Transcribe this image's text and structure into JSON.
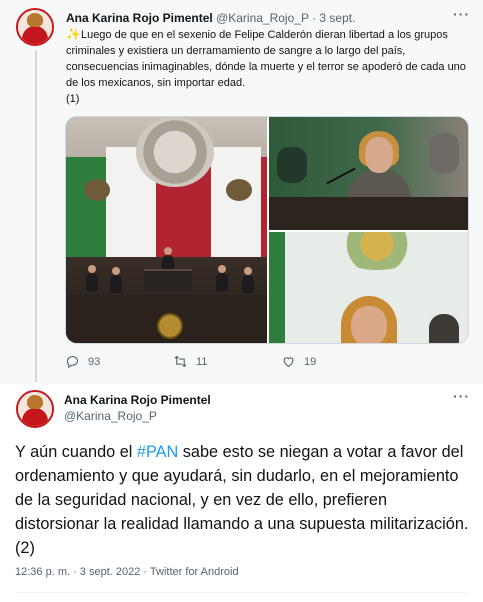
{
  "tweet1": {
    "author_name": "Ana Karina Rojo Pimentel",
    "handle": "@Karina_Rojo_P",
    "separator": "·",
    "date": "3 sept.",
    "sparkle": "✨",
    "text": "Luego de que en el sexenio de Felipe Calderón dieran libertad a los grupos criminales y existiera un derramamiento de sangre a lo largo del país, consecuencias inimaginables, dónde la muerte y el terror se apoderó de cada uno de los mexicanos, sin importar edad.",
    "counter": "(1)",
    "more_label": "···",
    "stats": {
      "replies": "93",
      "retweets": "11",
      "likes": "19"
    }
  },
  "tweet2": {
    "author_name": "Ana Karina Rojo Pimentel",
    "handle": "@Karina_Rojo_P",
    "more_label": "···",
    "text_before": "Y aún cuando el ",
    "hashtag": "#PAN",
    "text_after": " sabe esto se niegan a votar a favor del ordenamiento y que ayudará, sin dudarlo, en el mejoramiento de la seguridad nacional, y en vez de ello, prefieren distorsionar la realidad llamando a una supuesta militarización. (2)",
    "timestamp": "12:36 p. m. · 3 sept. 2022 · Twitter for Android"
  },
  "colors": {
    "accent": "#1d9bf0",
    "muted_text": "#536471",
    "context_bg": "#f7f9f9",
    "avatar_border": "#c4161c"
  }
}
